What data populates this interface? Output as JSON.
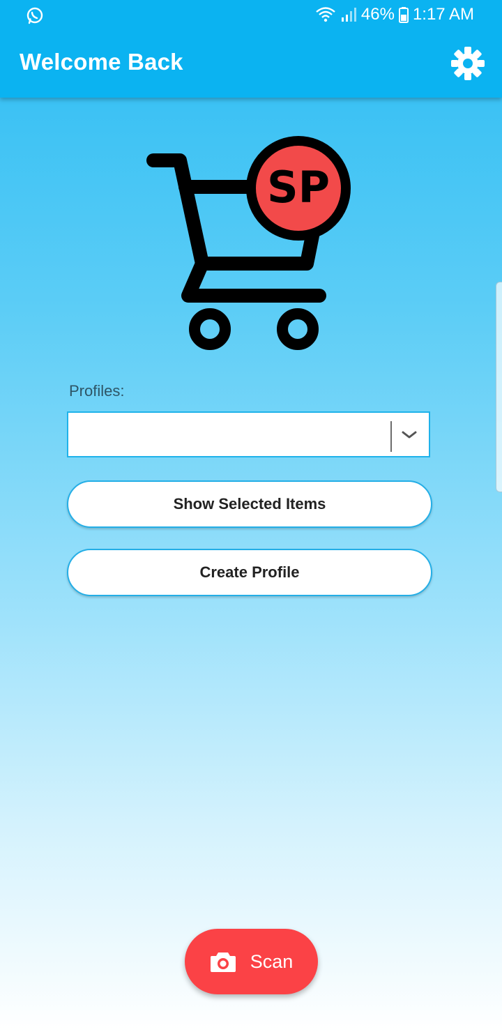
{
  "status_bar": {
    "battery": "46%",
    "time": "1:17 AM",
    "left_icon": "whatsapp-icon",
    "icons": [
      "wifi-icon",
      "signal-icon",
      "battery-icon"
    ]
  },
  "app_bar": {
    "title": "Welcome Back",
    "settings_icon": "gear-icon"
  },
  "logo": {
    "text": "SP",
    "icon": "shopping-cart-icon"
  },
  "profiles": {
    "label": "Profiles:",
    "selected_value": ""
  },
  "buttons": {
    "show_selected": "Show Selected Items",
    "create_profile": "Create Profile"
  },
  "scan": {
    "label": "Scan",
    "icon": "camera-icon"
  },
  "colors": {
    "app_bar": "#0bb3f1",
    "accent_red": "#fb4246",
    "button_border": "#24aee6",
    "logo_red": "#f24a4a"
  }
}
